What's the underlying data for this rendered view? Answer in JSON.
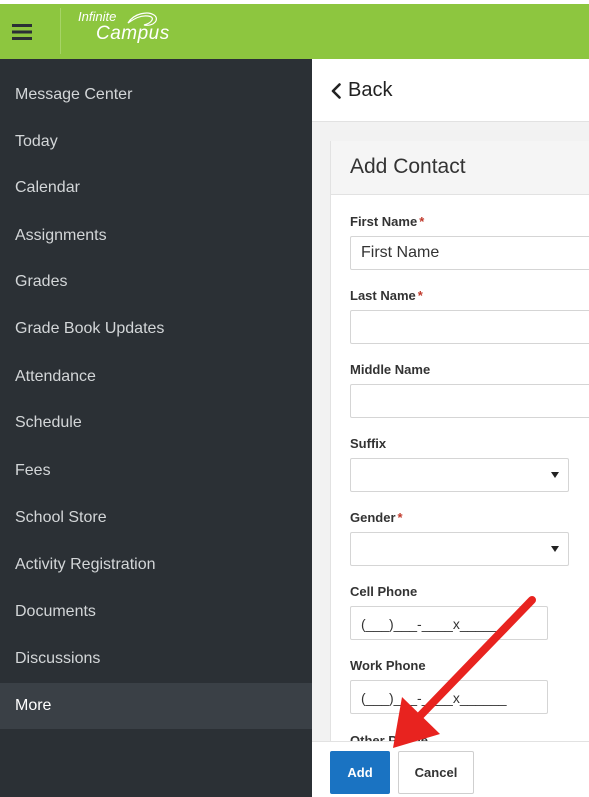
{
  "app": {
    "logo_line1": "Infinite",
    "logo_line2": "Campus",
    "brand_color": "#8dc63f"
  },
  "sidebar": {
    "items": [
      {
        "label": "Message Center"
      },
      {
        "label": "Today"
      },
      {
        "label": "Calendar"
      },
      {
        "label": "Assignments"
      },
      {
        "label": "Grades"
      },
      {
        "label": "Grade Book Updates"
      },
      {
        "label": "Attendance"
      },
      {
        "label": "Schedule"
      },
      {
        "label": "Fees"
      },
      {
        "label": "School Store"
      },
      {
        "label": "Activity Registration"
      },
      {
        "label": "Documents"
      },
      {
        "label": "Discussions"
      },
      {
        "label": "More",
        "active": true
      }
    ]
  },
  "header": {
    "back_label": "Back"
  },
  "form": {
    "title": "Add Contact",
    "first_name": {
      "label": "First Name",
      "required": "*",
      "placeholder": "First Name",
      "value": ""
    },
    "last_name": {
      "label": "Last Name",
      "required": "*",
      "value": ""
    },
    "middle_name": {
      "label": "Middle Name",
      "value": ""
    },
    "suffix": {
      "label": "Suffix",
      "selected": ""
    },
    "gender": {
      "label": "Gender",
      "required": "*",
      "selected": ""
    },
    "cell_phone": {
      "label": "Cell Phone",
      "placeholder": "(___)___-____x______"
    },
    "work_phone": {
      "label": "Work Phone",
      "placeholder": "(___)___-____x______"
    },
    "other_phone": {
      "label": "Other Phone"
    }
  },
  "footer": {
    "add_label": "Add",
    "cancel_label": "Cancel"
  },
  "annotation": {
    "arrow_color": "#e8231f"
  }
}
